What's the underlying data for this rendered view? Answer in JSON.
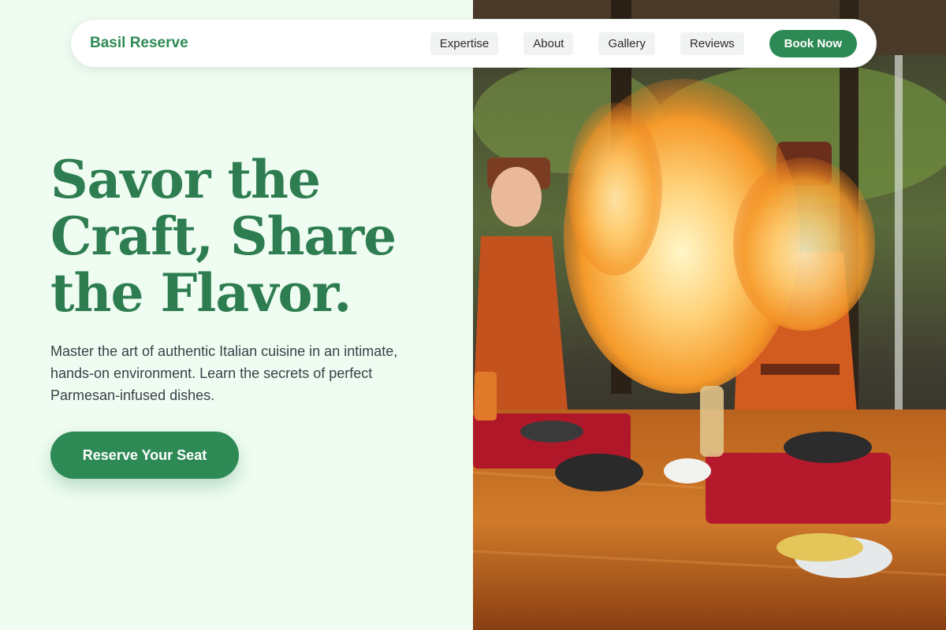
{
  "nav": {
    "brand": "Basil Reserve",
    "links": [
      "Expertise",
      "About",
      "Gallery",
      "Reviews"
    ],
    "cta_label": "Book Now"
  },
  "hero": {
    "headline_line1": "Savor the",
    "headline_line2": "Craft, Share",
    "headline_line3": "the Flavor.",
    "subtext": "Master the art of authentic Italian cuisine in an intimate, hands-on environment. Learn the secrets of perfect Parmesan-infused dishes.",
    "cta_label": "Reserve Your Seat"
  },
  "colors": {
    "brand": "#2e8a55",
    "background": "#effcf2",
    "text": "#3a4047"
  }
}
